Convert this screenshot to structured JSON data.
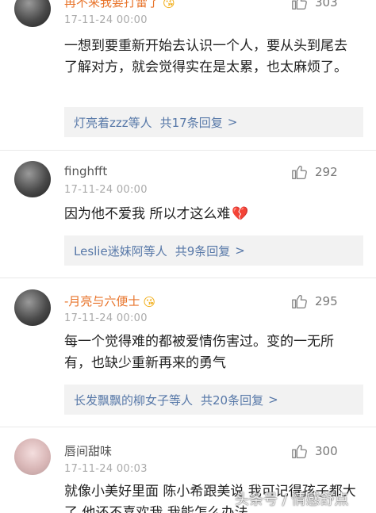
{
  "comments": [
    {
      "username": "再不来我要打雷了",
      "emoji": "😘",
      "time": "17-11-24 00:00",
      "likes": "303",
      "text": "一想到要重新开始去认识一个人，要从头到尾去了解对方，就会觉得实在是太累，也太麻烦了。",
      "reply_people": "灯亮着zzz等人",
      "reply_count": "共17条回复"
    },
    {
      "username": "finghfft",
      "time": "17-11-24 00:00",
      "likes": "292",
      "text": "因为他不爱我  所以才这么难",
      "text_emoji": "💔",
      "reply_people": "Leslie迷妹阿等人",
      "reply_count": "共9条回复"
    },
    {
      "username": "-月亮与六便士",
      "emoji": "😘",
      "time": "17-11-24 00:00",
      "likes": "295",
      "text": "每一个觉得难的都被爱情伤害过。变的一无所有，也缺少重新再来的勇气",
      "reply_people": "长发飘飘的柳女子等人",
      "reply_count": "共20条回复"
    },
    {
      "username": "唇间甜味",
      "time": "17-11-24 00:03",
      "likes": "300",
      "text": "就像小美好里面  陈小希跟美说 我可记得孩子都大了 他还不喜欢我 我能怎么办法"
    }
  ],
  "chevron": ">",
  "watermark": "头条号 / 情感舒点",
  "colors": {
    "vip_name": "#e8742b",
    "reply_link": "#5778a8",
    "reply_bg": "#f2f2f2",
    "heart": "#c52b3a"
  },
  "icons": {
    "like": "thumbs-up-icon",
    "chevron": "chevron-right-icon",
    "emoji": "smiley-emoji-icon",
    "heart": "broken-heart-icon"
  }
}
